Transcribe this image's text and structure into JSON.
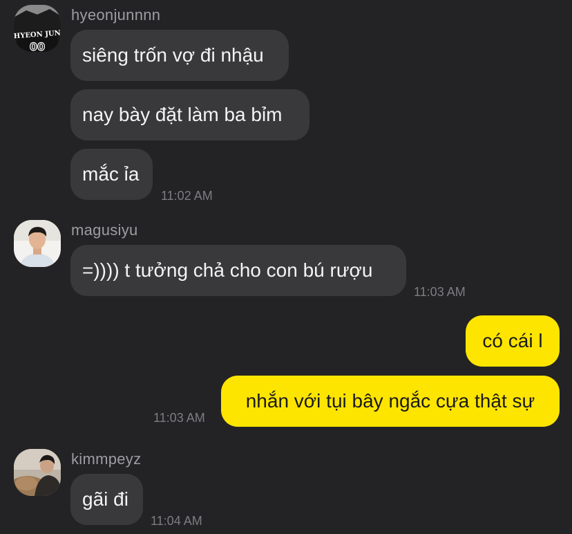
{
  "chat": {
    "groups": [
      {
        "sender": "hyeonjunnnn",
        "avatar_icon": "jersey-photo-avatar",
        "messages": [
          "siêng trốn vợ đi nhậu",
          "nay bày đặt làm ba bỉm",
          "mắc ỉa"
        ],
        "time": "11:02 AM"
      },
      {
        "sender": "magusiyu",
        "avatar_icon": "portrait-photo-avatar",
        "messages": [
          "=)))) t tưởng chả cho con bú rượu"
        ],
        "time": "11:03 AM"
      },
      {
        "sender": "me",
        "messages": [
          "có cái l",
          "nhắn với tụi bây ngắc cựa thật sự"
        ],
        "time": "11:03 AM"
      },
      {
        "sender": "kimmpeyz",
        "avatar_icon": "cat-photo-avatar",
        "messages": [
          "gãi đi"
        ],
        "time": "11:04 AM"
      }
    ],
    "avatar_badge_text": "HYEON JUN"
  },
  "colors": {
    "background": "#232325",
    "incoming_bubble": "#39393b",
    "outgoing_bubble": "#fee500",
    "sender_name": "#9d9da2",
    "timestamp": "#7d7d82"
  }
}
